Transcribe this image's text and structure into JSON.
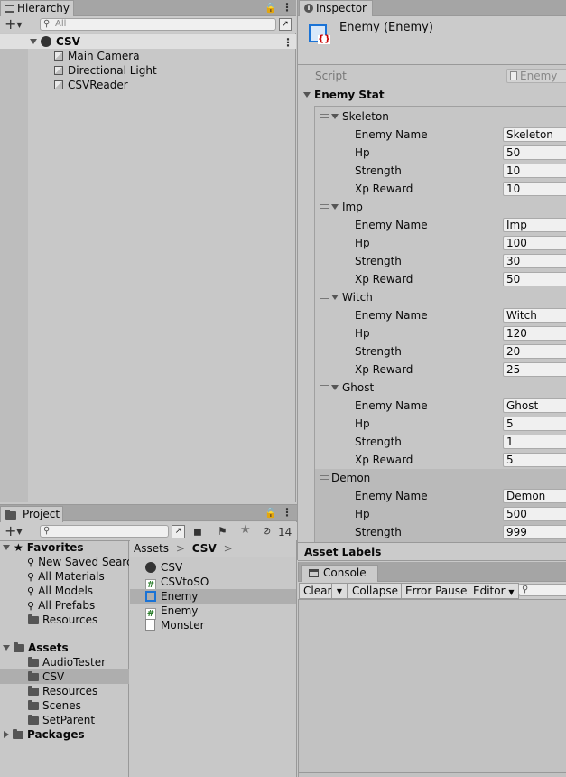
{
  "hierarchy": {
    "tab_label": "Hierarchy",
    "search_placeholder": "All",
    "scene_name": "CSV",
    "objects": [
      "Main Camera",
      "Directional Light",
      "CSVReader"
    ]
  },
  "inspector": {
    "tab_label": "Inspector",
    "title": "Enemy (Enemy)",
    "script_label": "Script",
    "script_value": "Enemy",
    "section_label": "Enemy Stat",
    "field_labels": {
      "name": "Enemy Name",
      "hp": "Hp",
      "strength": "Strength",
      "xp": "Xp Reward"
    },
    "enemies": [
      {
        "header": "Skeleton",
        "name": "Skeleton",
        "hp": "50",
        "strength": "10",
        "xp": "10"
      },
      {
        "header": "Imp",
        "name": "Imp",
        "hp": "100",
        "strength": "30",
        "xp": "50"
      },
      {
        "header": "Witch",
        "name": "Witch",
        "hp": "120",
        "strength": "20",
        "xp": "25"
      },
      {
        "header": "Ghost",
        "name": "Ghost",
        "hp": "5",
        "strength": "1",
        "xp": "5"
      },
      {
        "header": "Demon",
        "name": "Demon",
        "hp": "500",
        "strength": "999"
      }
    ],
    "asset_labels": "Asset Labels"
  },
  "project": {
    "tab_label": "Project",
    "hidden_count": "14",
    "favorites_label": "Favorites",
    "favorites": [
      "New Saved Search",
      "All Materials",
      "All Models",
      "All Prefabs",
      "Resources"
    ],
    "assets_label": "Assets",
    "asset_folders": [
      "AudioTester",
      "CSV",
      "Resources",
      "Scenes",
      "SetParent"
    ],
    "packages_label": "Packages",
    "breadcrumb": [
      "Assets",
      "CSV"
    ],
    "files": [
      "CSV",
      "CSVtoSO",
      "Enemy",
      "Enemy",
      "Monster"
    ]
  },
  "console": {
    "tab_label": "Console",
    "buttons": {
      "clear": "Clear",
      "collapse": "Collapse",
      "error_pause": "Error Pause",
      "editor": "Editor"
    }
  },
  "colors": {
    "selection": "#aeaeae",
    "panel": "#c8c8c8",
    "field": "#f0f0f0",
    "accent_blue": "#1a73d6"
  }
}
